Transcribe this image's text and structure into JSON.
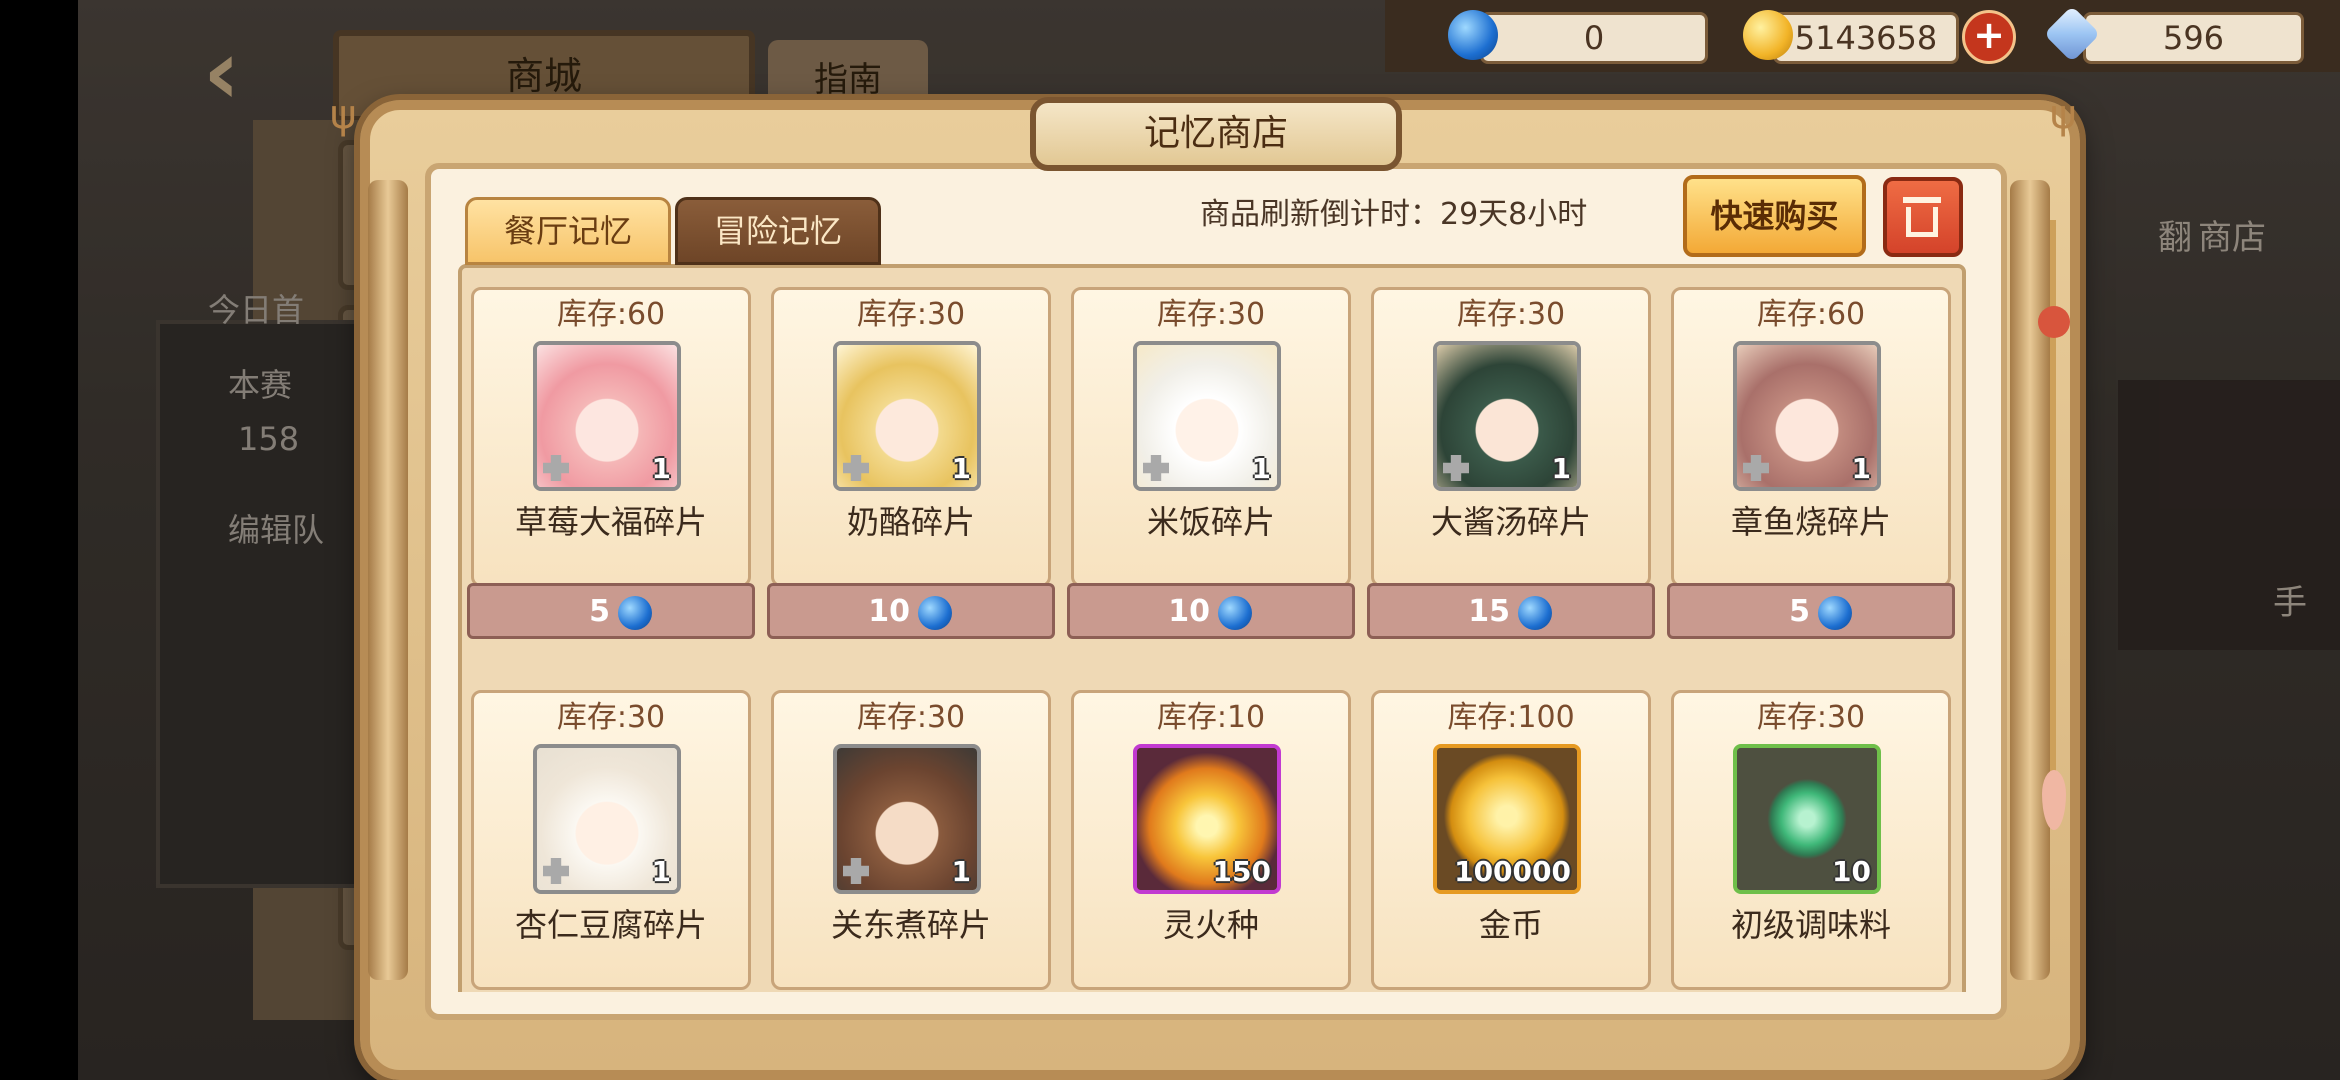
{
  "colors": {
    "gem": "#1d6fd1",
    "gold": "#f2b428",
    "tab_active": "#f7c46a",
    "tab_inactive": "#6e4527",
    "quick_buy": "#f3a936",
    "trash": "#d4432a",
    "price_bar": "#c99a8f"
  },
  "background": {
    "shop_title": "商城",
    "guide_label": "指南",
    "left_text_1": "今日首",
    "left_text_2": "本赛",
    "left_text_3": "158",
    "left_text_4": "编辑队",
    "right_text_1": "翻",
    "right_text_2": "商店",
    "right_text_3": "手"
  },
  "currency": {
    "gem_value": "0",
    "gold_value": "5143658",
    "crystal_value": "596",
    "plus_icon": "plus-icon"
  },
  "modal": {
    "title": "记忆商店",
    "tabs": [
      {
        "label": "餐厅记忆",
        "active": true
      },
      {
        "label": "冒险记忆",
        "active": false
      }
    ],
    "refresh_label": "商品刷新倒计时：29天8小时",
    "quick_buy_label": "快速购买"
  },
  "items": [
    {
      "stock": "库存:60",
      "name": "草莓大福碎片",
      "count": "1",
      "price": "5",
      "icon": "strawberry-daifuku-fragment-icon"
    },
    {
      "stock": "库存:30",
      "name": "奶酪碎片",
      "count": "1",
      "price": "10",
      "icon": "cheese-fragment-icon"
    },
    {
      "stock": "库存:30",
      "name": "米饭碎片",
      "count": "1",
      "price": "10",
      "icon": "rice-fragment-icon"
    },
    {
      "stock": "库存:30",
      "name": "大酱汤碎片",
      "count": "1",
      "price": "15",
      "icon": "miso-soup-fragment-icon"
    },
    {
      "stock": "库存:60",
      "name": "章鱼烧碎片",
      "count": "1",
      "price": "5",
      "icon": "takoyaki-fragment-icon"
    },
    {
      "stock": "库存:30",
      "name": "杏仁豆腐碎片",
      "count": "1",
      "icon": "almond-tofu-fragment-icon"
    },
    {
      "stock": "库存:30",
      "name": "关东煮碎片",
      "count": "1",
      "icon": "oden-fragment-icon"
    },
    {
      "stock": "库存:10",
      "name": "灵火种",
      "count": "150",
      "icon": "spirit-fire-seed-icon"
    },
    {
      "stock": "库存:100",
      "name": "金币",
      "count": "100000",
      "icon": "gold-coin-icon"
    },
    {
      "stock": "库存:30",
      "name": "初级调味料",
      "count": "10",
      "icon": "basic-seasoning-icon"
    }
  ]
}
